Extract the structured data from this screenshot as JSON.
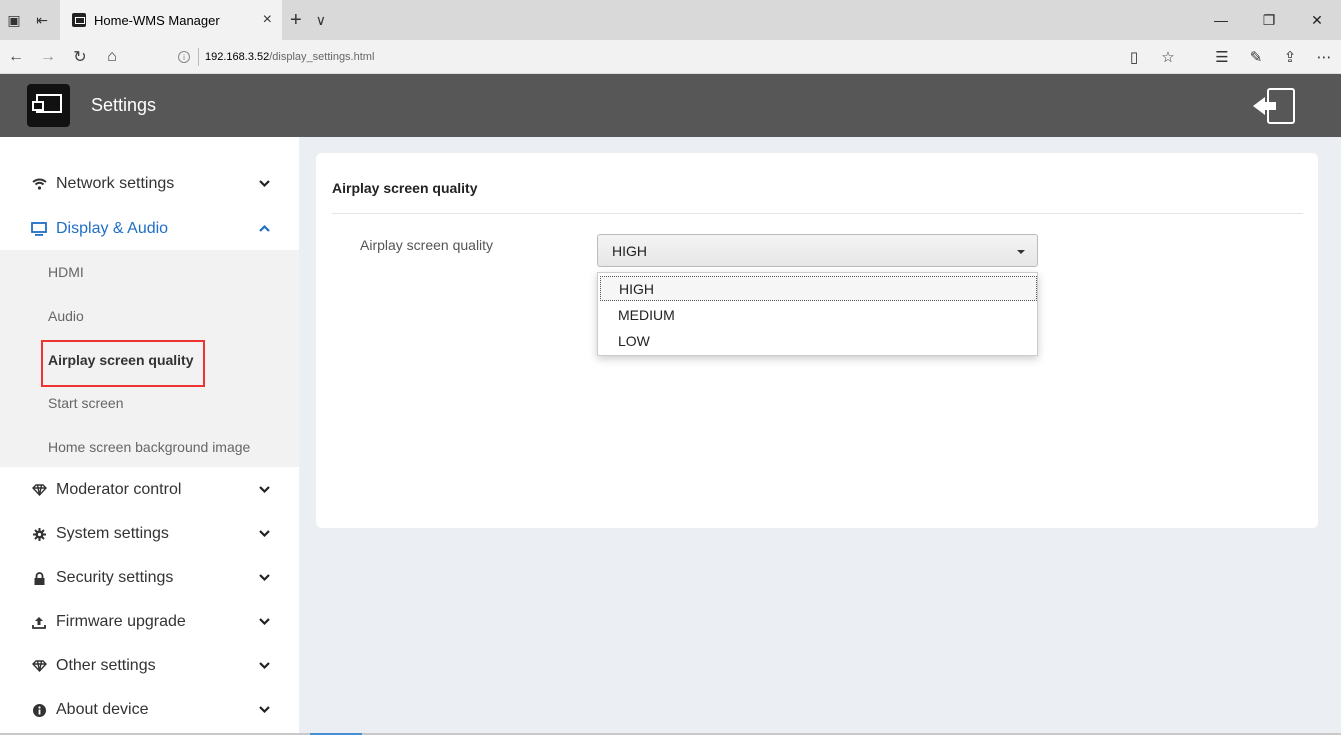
{
  "browser": {
    "tab_title": "Home-WMS Manager",
    "tab_close": "×",
    "new_tab": "+",
    "tab_menu": "∨",
    "url_host": "192.168.3.52",
    "url_path": "/display_settings.html",
    "minimize": "—",
    "restore": "❐",
    "close": "✕"
  },
  "header": {
    "title": "Settings"
  },
  "sidebar": {
    "items": [
      {
        "label": "Network settings"
      },
      {
        "label": "Display & Audio"
      },
      {
        "label": "Moderator control"
      },
      {
        "label": "System settings"
      },
      {
        "label": "Security settings"
      },
      {
        "label": "Firmware upgrade"
      },
      {
        "label": "Other settings"
      },
      {
        "label": "About device"
      }
    ],
    "sub_items": [
      {
        "label": "HDMI"
      },
      {
        "label": "Audio"
      },
      {
        "label": "Airplay screen quality"
      },
      {
        "label": "Start screen"
      },
      {
        "label": "Home screen background image"
      }
    ]
  },
  "main": {
    "card_title": "Airplay screen quality",
    "field_label": "Airplay screen quality",
    "select_value": "HIGH",
    "options": [
      "HIGH",
      "MEDIUM",
      "LOW"
    ]
  },
  "colors": {
    "header_bg": "#575757",
    "active_blue": "#1f6fc5",
    "highlight_red": "#e33333",
    "page_bg": "#ebeef2"
  }
}
